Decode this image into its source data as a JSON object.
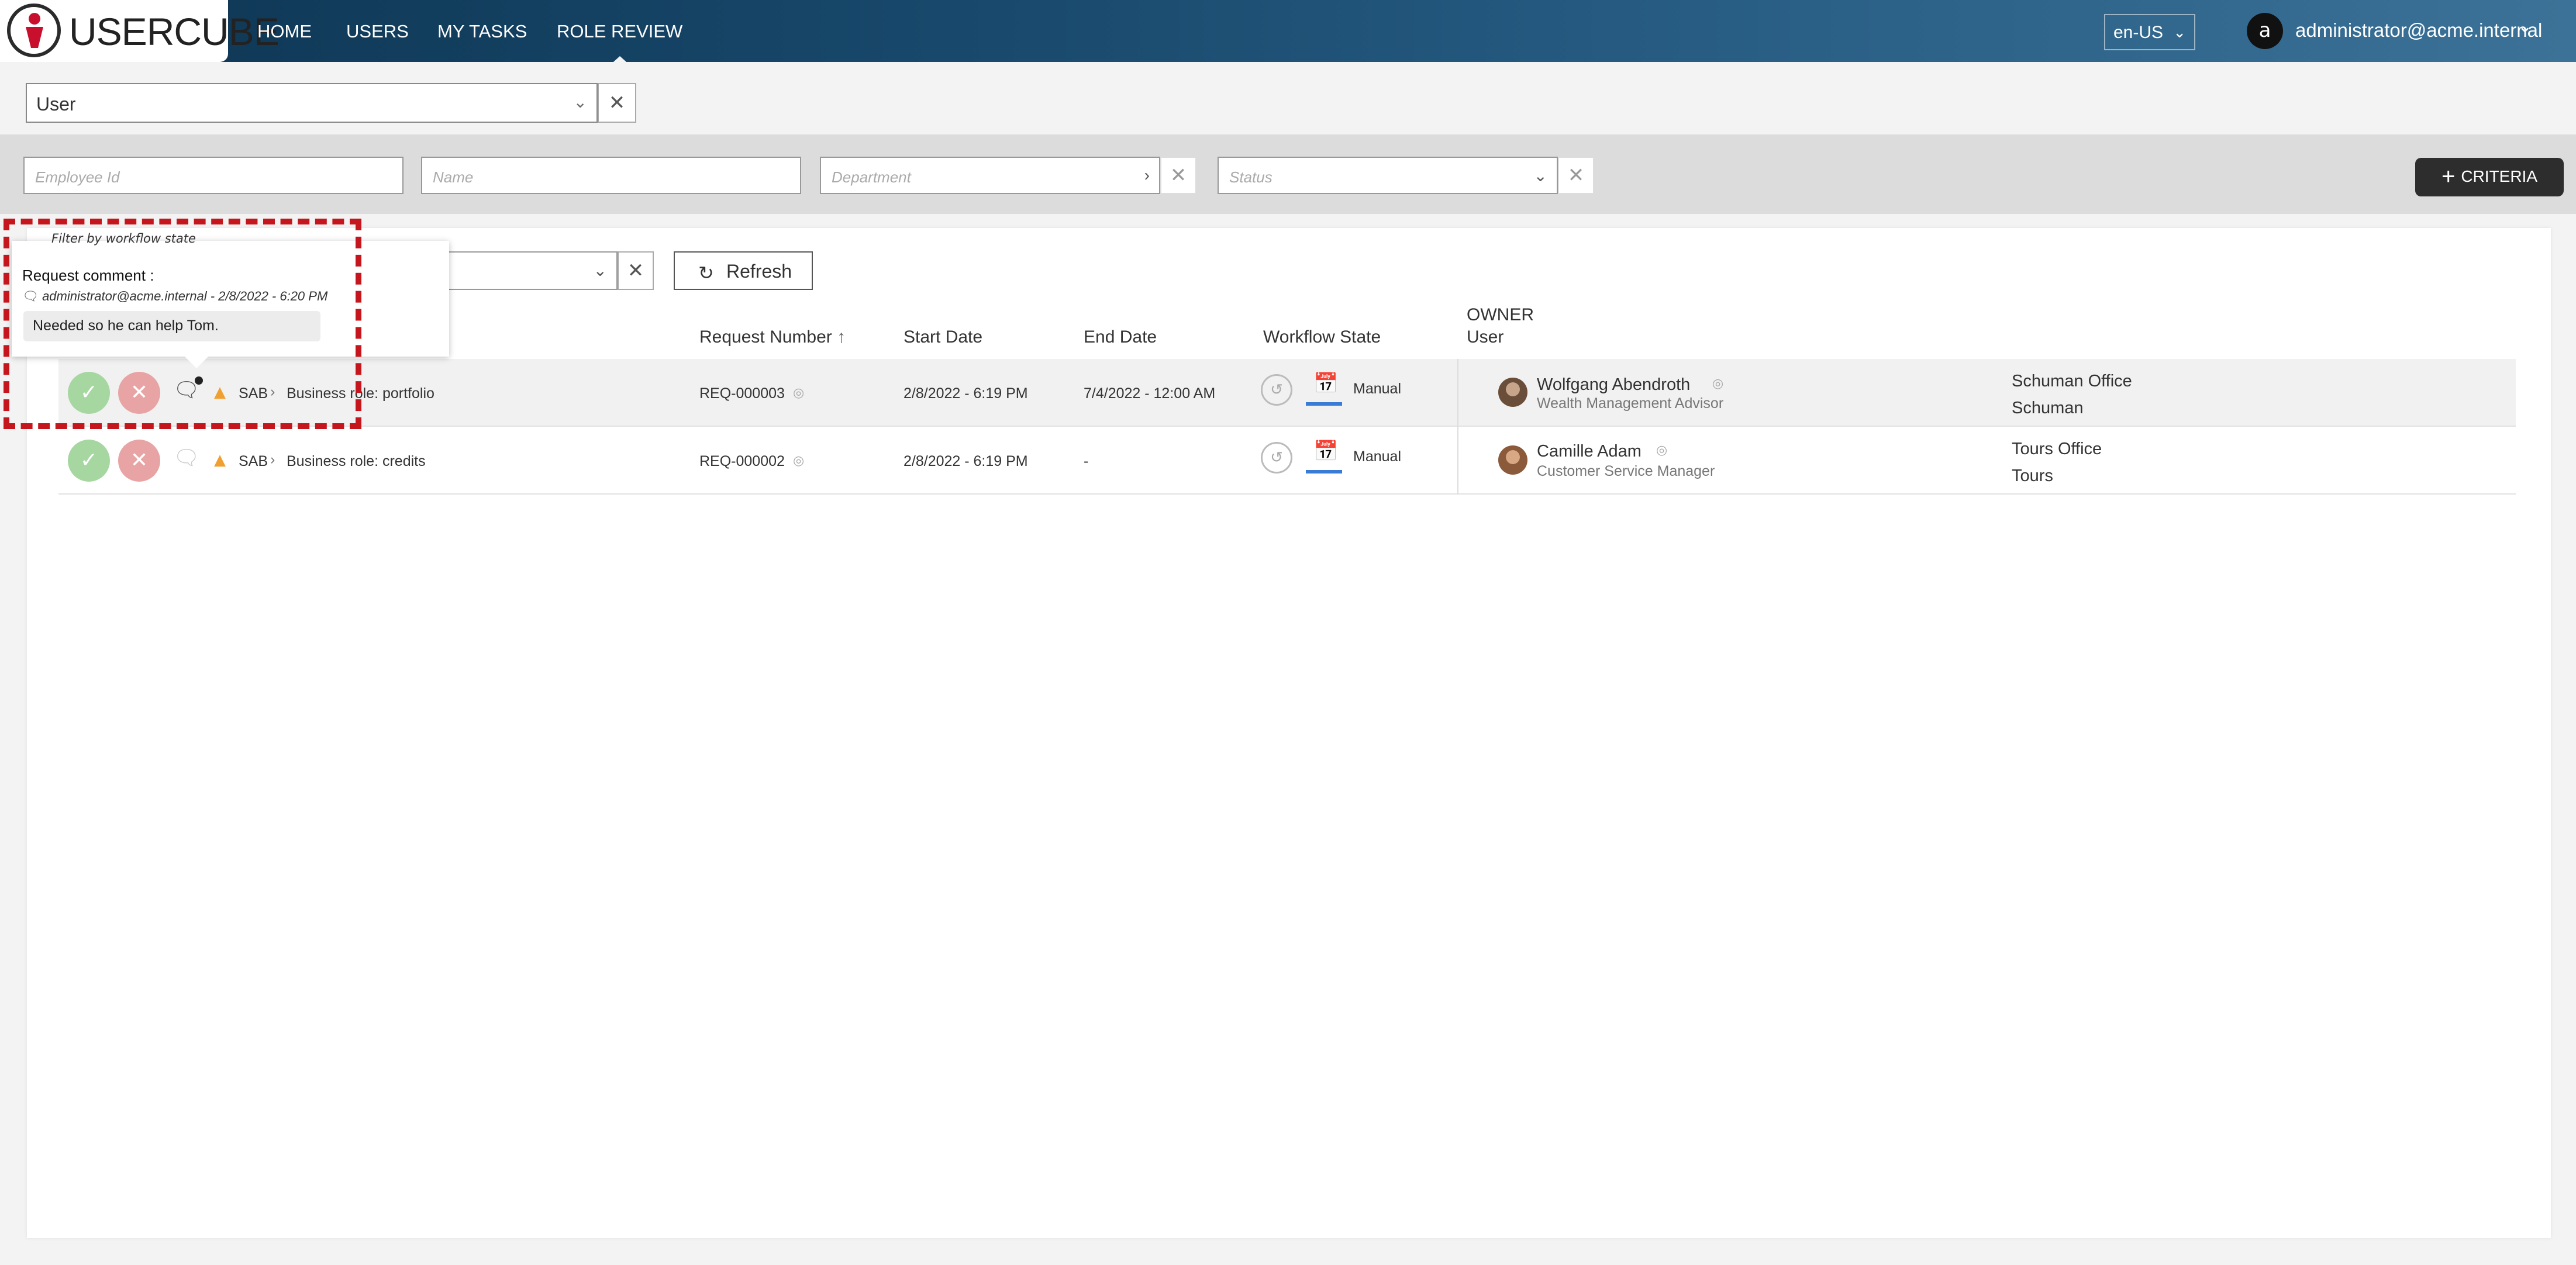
{
  "header": {
    "logo_text": "USERCUBE",
    "nav": [
      {
        "label": "HOME"
      },
      {
        "label": "USERS"
      },
      {
        "label": "MY TASKS"
      },
      {
        "label": "ROLE REVIEW",
        "active": true
      }
    ],
    "language": "en-US",
    "user": {
      "initial": "a",
      "email": "administrator@acme.internal"
    }
  },
  "entity_select": {
    "value": "User"
  },
  "filters": {
    "employee_id_placeholder": "Employee Id",
    "name_placeholder": "Name",
    "department_placeholder": "Department",
    "status_placeholder": "Status",
    "criteria_label": "CRITERIA"
  },
  "toolbar": {
    "workflow_filter_label": "Filter by workflow state",
    "refresh_label": "Refresh"
  },
  "table": {
    "headers": {
      "request_number": "Request Number",
      "start_date": "Start Date",
      "end_date": "End Date",
      "workflow_state": "Workflow State",
      "owner": "OWNER",
      "user": "User"
    },
    "rows": [
      {
        "resource_type": "SAB",
        "role": "Business role: portfolio",
        "request_number": "REQ-000003",
        "start_date": "2/8/2022  - 6:19 PM",
        "end_date": "7/4/2022  - 12:00 AM",
        "workflow_state": "Manual",
        "owner_name": "Wolfgang Abendroth",
        "owner_title": "Wealth Management Advisor",
        "location": "Schuman Office",
        "location_short": "Schuman",
        "has_comment": true
      },
      {
        "resource_type": "SAB",
        "role": "Business role: credits",
        "request_number": "REQ-000002",
        "start_date": "2/8/2022  - 6:19 PM",
        "end_date": "-",
        "workflow_state": "Manual",
        "owner_name": "Camille Adam",
        "owner_title": "Customer Service Manager",
        "location": "Tours Office",
        "location_short": "Tours",
        "has_comment": false
      }
    ]
  },
  "tooltip": {
    "title": "Request comment :",
    "meta": "administrator@acme.internal - 2/8/2022  - 6:20 PM",
    "text": "Needed so he can help Tom."
  },
  "colors": {
    "header_dark": "#0e3552",
    "header_light": "#3c7297",
    "approve": "#a6d7a1",
    "reject": "#e8a4a4",
    "highlight": "#c4161c",
    "workflow_underline": "#3a7bd5"
  },
  "icons": {
    "approve": "check-icon",
    "reject": "close-icon",
    "comment": "comment-icon",
    "warning": "warning-icon",
    "history": "history-icon",
    "calendar": "calendar-icon",
    "visibility": "eye-icon"
  }
}
